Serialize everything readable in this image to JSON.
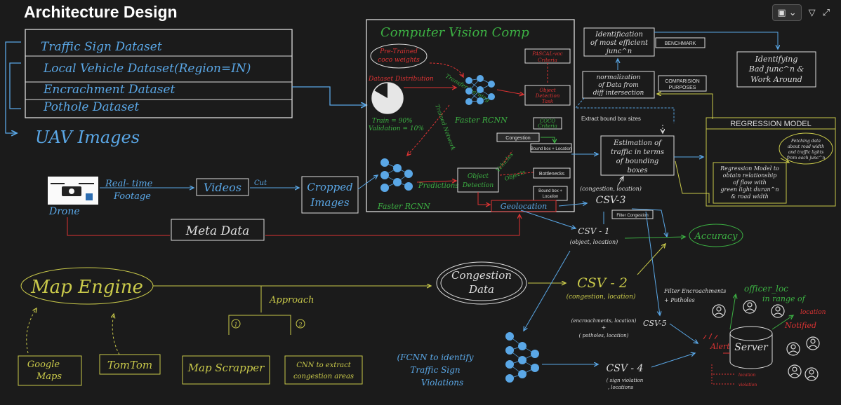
{
  "page": {
    "title": "Architecture Design",
    "toolbar_icons": [
      "screen-share-icon",
      "chevron-down-icon",
      "pin-icon",
      "expand-icon"
    ]
  },
  "datasets": {
    "items": [
      "Traffic Sign Dataset",
      "Local Vehicle Dataset(Region=IN)",
      "Encrachment Dataset",
      "Pothole Dataset"
    ],
    "uav": "UAV Images"
  },
  "cv_comp": {
    "title": "Computer Vision Comp",
    "pretrained": [
      "Pre-Trained",
      "coco weights"
    ],
    "dataset_distribution": "Dataset Distribution",
    "train_split": "Train = 90%",
    "validation_split": "Validation = 10%",
    "transfer_learning": "Transfer learning",
    "trained_network": "Trained Network",
    "faster_rcnn_top": "Faster RCNN",
    "faster_rcnn_bottom": "Faster RCNN",
    "pascal_voc": [
      "PASCAL-voc",
      "Criteria"
    ],
    "object_detection_task": [
      "Object",
      "Detection",
      "Task"
    ],
    "coco_criteria": [
      "COCO",
      "Criteria"
    ],
    "congestion": "Congestion",
    "bound_box_location": "Bound box + Location",
    "object_detection": [
      "Object",
      "Detection"
    ],
    "predictions": "Predictions",
    "objects": "Objects",
    "vehicles": "Vehicles",
    "bottlenecks": "Bottlenecks",
    "bound_box_location_2": [
      "Bound box +",
      "Location"
    ],
    "geolocation": "Geolocation"
  },
  "pipeline": {
    "drone": "Drone",
    "realtime": [
      "Real- time",
      "Footage"
    ],
    "videos": "Videos",
    "cut": "Cut",
    "cropped": [
      "Cropped",
      "Images"
    ],
    "meta_data": "Meta Data"
  },
  "right_side": {
    "identification": [
      "Identification",
      "of most efficient",
      "junc^n"
    ],
    "benchmark": "BENCHMARK",
    "identifying": [
      "Identifying",
      "Bad junc^n &",
      "Work Around"
    ],
    "normalization": [
      "normalization",
      "of Data from",
      "diff intersection"
    ],
    "comparison": [
      "COMPARISION",
      "PURPOSES"
    ],
    "extract": "Extract bound box sizes",
    "estimation": [
      "Estimation of",
      "traffic in terms",
      "of bounding",
      "boxes"
    ],
    "regression_title": "REGRESSION MODEL",
    "fetching": [
      "Fetching data",
      "about road width",
      "and traffic lights",
      "from each junc^n"
    ],
    "regression_body": [
      "Regression Model to",
      "obtain relationship",
      "of flow with",
      "green light duran^n",
      "& road width"
    ],
    "csv3_header": "(congestion, location)",
    "csv3": "CSV-3",
    "filter_congestion": "Filter Congestion",
    "csv1": "CSV - 1",
    "csv1_sub": "(object, location)",
    "accuracy": "Accuracy"
  },
  "bottom": {
    "map_engine": "Map Engine",
    "approach": "Approach",
    "step1": "1",
    "step2": "2",
    "google_maps": [
      "Google",
      "Maps"
    ],
    "tomtom": "TomTom",
    "map_scrapper": "Map Scrapper",
    "cnn_extract": [
      "CNN to extract",
      "congestion areas"
    ],
    "congestion_data": [
      "Congestion",
      "Data"
    ],
    "csv2": "CSV - 2",
    "csv2_sub": "(congestion, location)",
    "filter_enc": [
      "Filter Encroachments",
      "+ Potholes"
    ],
    "csv5_left": [
      "(encroachments, location)",
      "+",
      "( potholes, location)"
    ],
    "csv5": "CSV-5",
    "fcnn": [
      "(FCNN to identify",
      "Traffic Sign",
      "Violations"
    ],
    "csv4": "CSV - 4",
    "csv4_sub": [
      "( sign violation",
      ", locations"
    ],
    "alert": "Alert",
    "server": "Server",
    "location_small": "location",
    "violation_small": "violation",
    "officer_loc": "officer_loc",
    "in_range": "in range of",
    "location_notified": [
      "location",
      "Notified"
    ]
  }
}
